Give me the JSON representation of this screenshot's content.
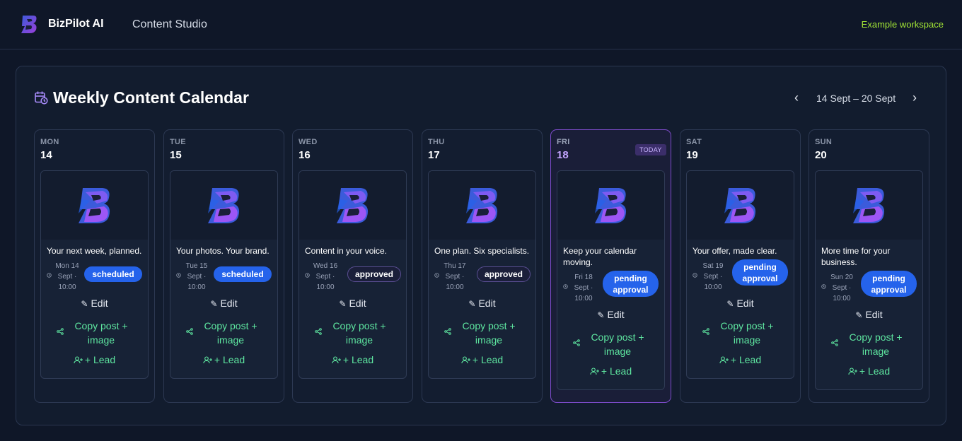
{
  "header": {
    "brand": "BizPilot AI",
    "section": "Content Studio",
    "workspace": "Example workspace"
  },
  "panel": {
    "title": "Weekly Content Calendar",
    "range": "14 Sept – 20 Sept",
    "prev_glyph": "‹",
    "next_glyph": "›"
  },
  "labels": {
    "edit": "Edit",
    "copy": "Copy post + image",
    "lead": "+ Lead",
    "today": "TODAY"
  },
  "colors": {
    "accent_purple": "#7c4bc9",
    "status_blue": "#2563eb",
    "action_green": "#5ee6a0",
    "workspace_green": "#a3e635"
  },
  "days": [
    {
      "name": "MON",
      "num": "14",
      "caption": "Your next week, planned.",
      "date": "Mon 14",
      "month": "Sept ·",
      "time": "10:00",
      "status": "scheduled",
      "today": false
    },
    {
      "name": "TUE",
      "num": "15",
      "caption": "Your photos. Your brand.",
      "date": "Tue 15",
      "month": "Sept ·",
      "time": "10:00",
      "status": "scheduled",
      "today": false
    },
    {
      "name": "WED",
      "num": "16",
      "caption": "Content in your voice.",
      "date": "Wed 16",
      "month": "Sept ·",
      "time": "10:00",
      "status": "approved",
      "today": false
    },
    {
      "name": "THU",
      "num": "17",
      "caption": "One plan. Six specialists.",
      "date": "Thu 17",
      "month": "Sept ·",
      "time": "10:00",
      "status": "approved",
      "today": false
    },
    {
      "name": "FRI",
      "num": "18",
      "caption": "Keep your calendar moving.",
      "date": "Fri 18",
      "month": "Sept ·",
      "time": "10:00",
      "status": "pending approval",
      "today": true
    },
    {
      "name": "SAT",
      "num": "19",
      "caption": "Your offer, made clear.",
      "date": "Sat 19",
      "month": "Sept ·",
      "time": "10:00",
      "status": "pending approval",
      "today": false
    },
    {
      "name": "SUN",
      "num": "20",
      "caption": "More time for your business.",
      "date": "Sun 20",
      "month": "Sept ·",
      "time": "10:00",
      "status": "pending approval",
      "today": false
    }
  ]
}
